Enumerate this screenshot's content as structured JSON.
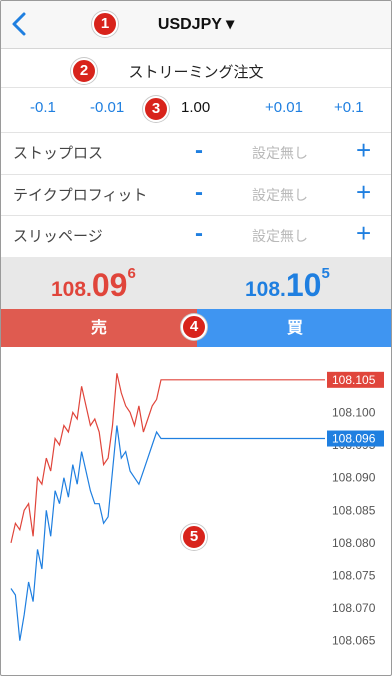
{
  "header": {
    "back_icon": "chevron-left-icon",
    "symbol": "USDJPY ▾"
  },
  "markers": [
    "1",
    "2",
    "3",
    "4",
    "5"
  ],
  "order": {
    "type_label": "ストリーミング注文"
  },
  "lot": {
    "steps_minus": [
      "-0.1",
      "-0.01"
    ],
    "value": "1.00",
    "steps_plus": [
      "+0.01",
      "+0.1"
    ]
  },
  "params": [
    {
      "label": "ストップロス",
      "minus": "-",
      "value": "設定無し",
      "plus": "+"
    },
    {
      "label": "テイクプロフィット",
      "minus": "-",
      "value": "設定無し",
      "plus": "+"
    },
    {
      "label": "スリッページ",
      "minus": "-",
      "value": "設定無し",
      "plus": "+"
    }
  ],
  "prices": {
    "bid": {
      "small": "108.",
      "big": "09",
      "sup": "6"
    },
    "ask": {
      "small": "108.",
      "big": "10",
      "sup": "5"
    }
  },
  "trade": {
    "sell_label": "売",
    "buy_label": "買"
  },
  "colors": {
    "bid": "#e0453b",
    "ask": "#1f7fe0",
    "sell_bg": "#df5b50",
    "buy_bg": "#3f95f1"
  },
  "chart_data": {
    "type": "line",
    "title": "",
    "xlabel": "",
    "ylabel": "",
    "ylim": [
      108.0625,
      108.1085
    ],
    "y_ticks": [
      "108.105",
      "108.100",
      "108.095",
      "108.090",
      "108.085",
      "108.080",
      "108.075",
      "108.070",
      "108.065"
    ],
    "series": [
      {
        "color": "#e0453b",
        "last_value_tag": "108.105",
        "values": [
          108.08,
          108.083,
          108.082,
          108.085,
          108.086,
          108.081,
          108.09,
          108.089,
          108.093,
          108.091,
          108.096,
          108.095,
          108.098,
          108.097,
          108.1,
          108.099,
          108.104,
          108.101,
          108.098,
          108.099,
          108.097,
          108.092,
          108.093,
          108.098,
          108.106,
          108.103,
          108.101,
          108.1,
          108.098,
          108.101,
          108.097,
          108.099,
          108.101,
          108.102,
          108.105,
          108.105,
          108.105,
          108.105,
          108.105,
          108.105,
          108.105,
          108.105,
          108.105,
          108.105,
          108.105,
          108.105
        ]
      },
      {
        "color": "#1f7fe0",
        "last_value_tag": "108.096",
        "values": [
          108.073,
          108.072,
          108.065,
          108.069,
          108.074,
          108.071,
          108.079,
          108.076,
          108.085,
          108.081,
          108.088,
          108.086,
          108.09,
          108.087,
          108.092,
          108.089,
          108.094,
          108.091,
          108.088,
          108.086,
          108.086,
          108.083,
          108.084,
          108.091,
          108.098,
          108.093,
          108.094,
          108.091,
          108.09,
          108.089,
          108.091,
          108.093,
          108.095,
          108.097,
          108.096,
          108.096,
          108.096,
          108.096,
          108.096,
          108.096,
          108.096,
          108.096,
          108.096,
          108.096,
          108.096,
          108.096
        ]
      }
    ]
  }
}
